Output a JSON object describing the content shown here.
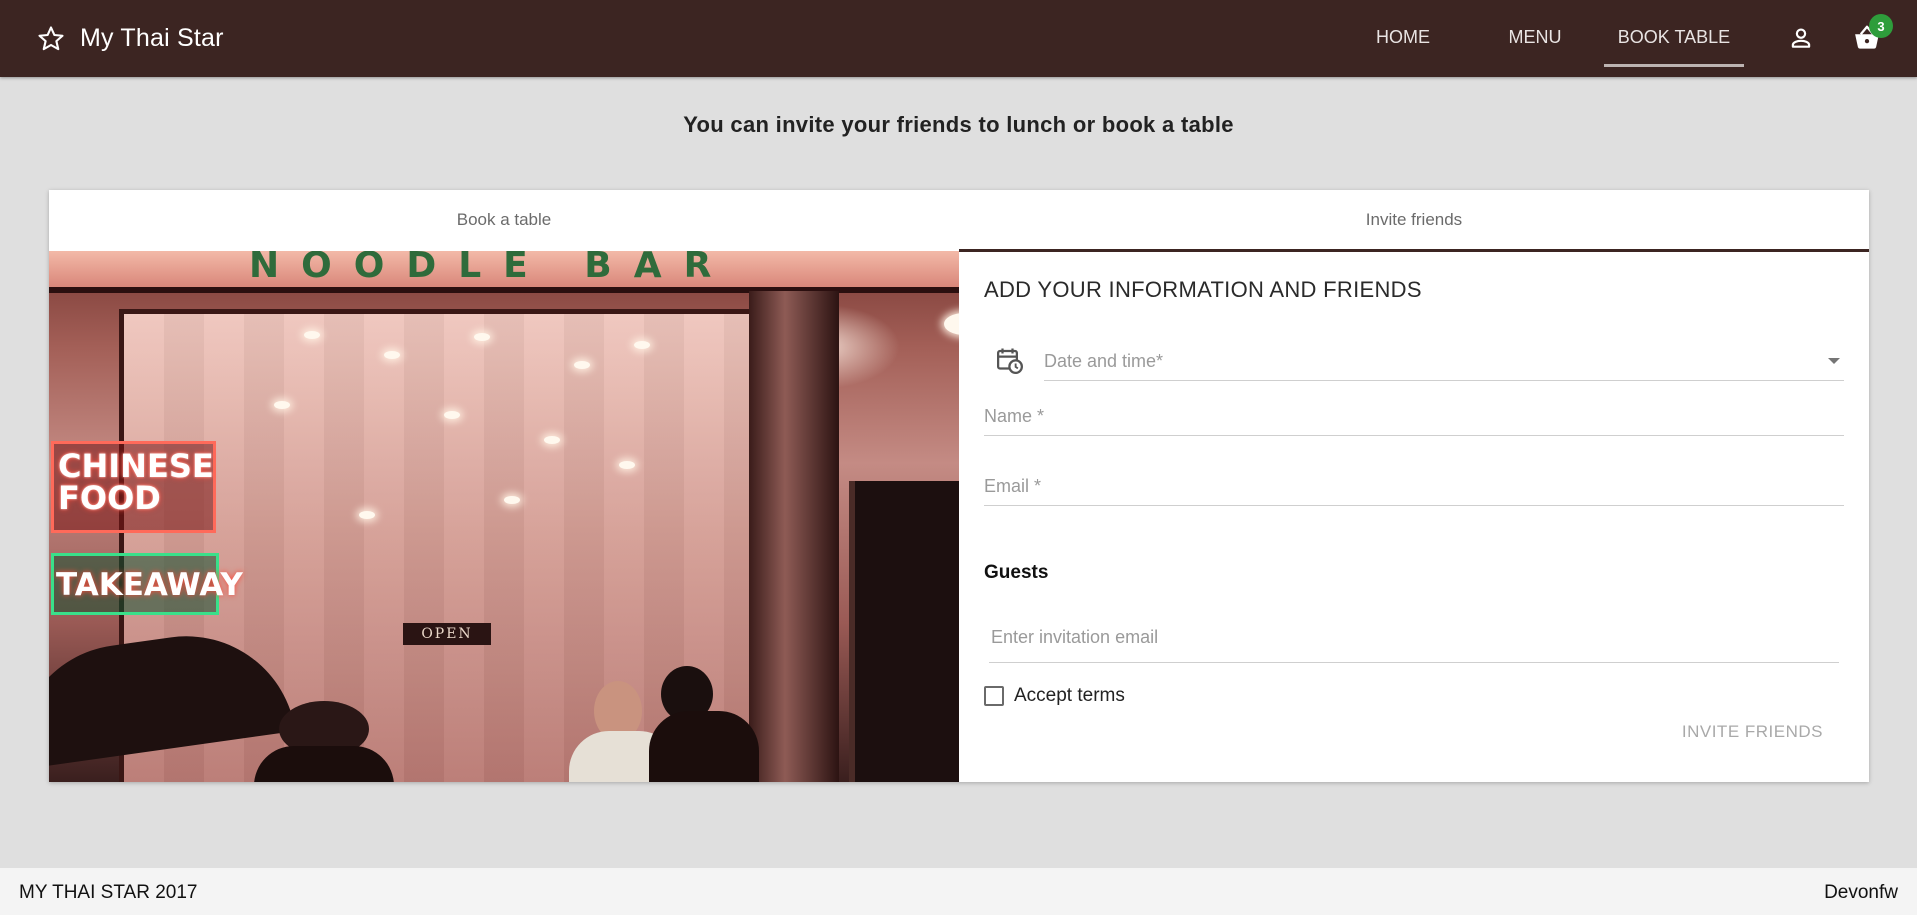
{
  "app": {
    "title": "My Thai Star"
  },
  "nav": {
    "items": [
      {
        "label": "HOME",
        "active": false
      },
      {
        "label": "MENU",
        "active": false
      },
      {
        "label": "BOOK TABLE",
        "active": true
      }
    ],
    "user_icon": "person-icon",
    "cart_icon": "basket-icon",
    "cart_count": "3"
  },
  "page": {
    "headline": "You can invite your friends to lunch or book a table"
  },
  "tabs": [
    {
      "label": "Book a table",
      "active": false
    },
    {
      "label": "Invite friends",
      "active": true
    }
  ],
  "photo": {
    "sign_top": "NOODLE BAR",
    "neon_1": "CHINESE FOOD",
    "neon_2": "TAKEAWAY",
    "open_sign": "OPEN"
  },
  "form": {
    "title": "ADD YOUR INFORMATION AND FRIENDS",
    "date_placeholder": "Date and time*",
    "name_placeholder": "Name *",
    "email_placeholder": "Email *",
    "guests_label": "Guests",
    "invitation_placeholder": "Enter invitation email",
    "accept_terms_label": "Accept terms",
    "accept_terms_checked": false,
    "submit_label": "INVITE FRIENDS"
  },
  "footer": {
    "left": "MY THAI STAR 2017",
    "right": "Devonfw"
  },
  "colors": {
    "toolbar": "#3c2522",
    "badge": "#2e9d3b",
    "background": "#dfdfdf"
  }
}
